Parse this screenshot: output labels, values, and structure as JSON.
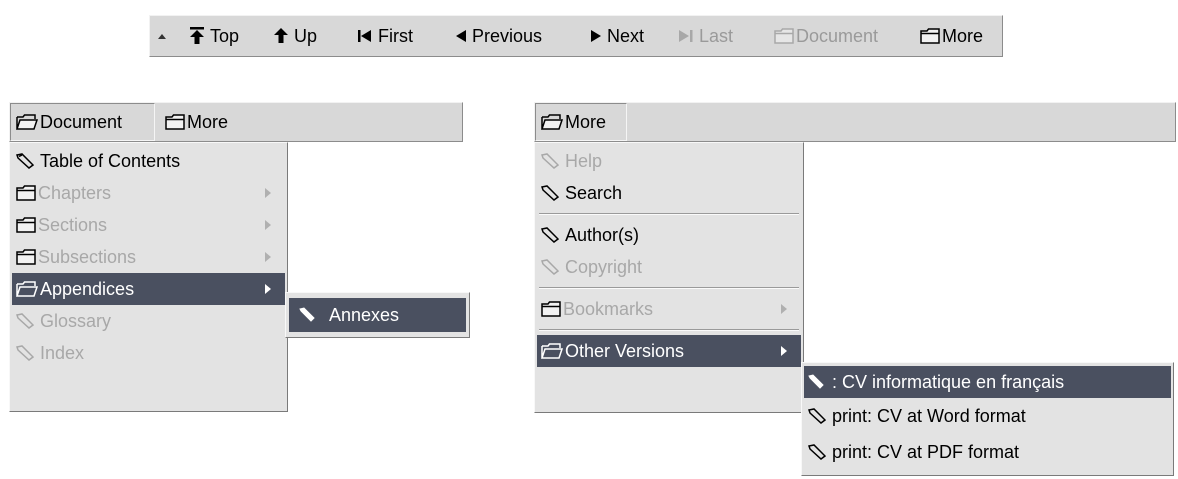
{
  "navbar": {
    "collapse_icon": "triangle-up-icon",
    "top": "Top",
    "up": "Up",
    "first": "First",
    "previous": "Previous",
    "next": "Next",
    "last": "Last",
    "document": "Document",
    "more": "More"
  },
  "document_panel": {
    "header_document": "Document",
    "header_more": "More",
    "items": [
      {
        "label": "Table of Contents",
        "icon": "pencil-icon",
        "state": "enabled"
      },
      {
        "label": "Chapters",
        "icon": "folder-icon",
        "state": "disabled",
        "submenu": true
      },
      {
        "label": "Sections",
        "icon": "folder-icon",
        "state": "disabled",
        "submenu": true
      },
      {
        "label": "Subsections",
        "icon": "folder-icon",
        "state": "disabled",
        "submenu": true
      },
      {
        "label": "Appendices",
        "icon": "folder-open-icon",
        "state": "selected",
        "submenu": true
      },
      {
        "label": "Glossary",
        "icon": "pencil-icon",
        "state": "disabled"
      },
      {
        "label": "Index",
        "icon": "pencil-icon",
        "state": "disabled"
      }
    ],
    "submenu_annexes": "Annexes"
  },
  "more_panel": {
    "header_more": "More",
    "items": {
      "help": "Help",
      "search": "Search",
      "authors": "Author(s)",
      "copyright": "Copyright",
      "bookmarks": "Bookmarks",
      "other_versions": "Other Versions"
    },
    "versions_submenu": [
      ": CV informatique en français",
      "print: CV at Word format",
      "print: CV at PDF format"
    ]
  },
  "colors": {
    "bar_bg": "#d8d8d8",
    "menu_bg": "#e3e3e3",
    "selected_bg": "#4a5060",
    "disabled_text": "#a8a8a8"
  }
}
